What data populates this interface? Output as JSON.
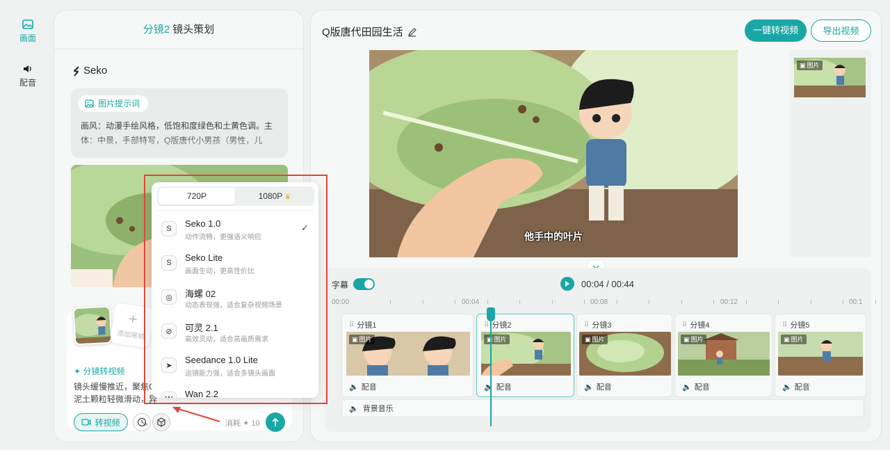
{
  "rail": {
    "items": [
      {
        "label": "画面",
        "active": true,
        "icon": "image-icon"
      },
      {
        "label": "配音",
        "active": false,
        "icon": "speaker-icon"
      }
    ]
  },
  "story": {
    "header_tab": "分镜2",
    "header_title": "镜头策划",
    "logo": "Seko",
    "prompt_chip": "图片提示词",
    "prompt_text": "画风：动漫手绘风格，低饱和度绿色和土黄色调。主体：中景，手部特写，Q版唐代小男孩（男性，儿",
    "add_tail": "添加尾帧",
    "gen_title": "分镜转视频",
    "gen_desc_1": "镜头缓慢推近，聚焦C",
    "gen_desc_2": "泥土颗粒轻微滑动，异",
    "to_video_label": "转视频",
    "clock_badge": "5s",
    "cost_label": "消耗",
    "cost_value": "10"
  },
  "main": {
    "project_title": "Q版唐代田园生活",
    "btn_oneclick": "一键转视频",
    "btn_export": "导出视频",
    "subtitle_text": "他手中的叶片",
    "side_badge": "图片"
  },
  "timeline": {
    "subtitle_label": "字幕",
    "subtitle_on": true,
    "current_time": "00:04",
    "total_time": "00:44",
    "time_sep": "/",
    "ruler": [
      "00:00",
      "00:04",
      "00:08",
      "00:12",
      "00:1"
    ],
    "clips": [
      {
        "label": "分镜1",
        "badge": "图片",
        "dub": "配音",
        "selected": false
      },
      {
        "label": "分镜2",
        "badge": "图片",
        "dub": "配音",
        "selected": true
      },
      {
        "label": "分镜3",
        "badge": "图片",
        "dub": "配音",
        "selected": false
      },
      {
        "label": "分镜4",
        "badge": "图片",
        "dub": "配音",
        "selected": false
      },
      {
        "label": "分镜5",
        "badge": "图片",
        "dub": "配音",
        "selected": false
      }
    ],
    "bgm_label": "背景音乐",
    "playhead_progress": 0.09
  },
  "popover": {
    "resolutions": [
      {
        "label": "720P",
        "selected": true,
        "premium": false
      },
      {
        "label": "1080P",
        "selected": false,
        "premium": true
      }
    ],
    "models": [
      {
        "name": "Seko 1.0",
        "desc": "动作流畅，更强语义响应",
        "selected": true,
        "icon": "seko-icon"
      },
      {
        "name": "Seko Lite",
        "desc": "画面生动，更高性价比",
        "selected": false,
        "icon": "seko-icon"
      },
      {
        "name": "海螺 02",
        "desc": "动态表现强，适合复杂视频场景",
        "selected": false,
        "icon": "hailuo-icon"
      },
      {
        "name": "可灵 2.1",
        "desc": "高效灵动，适合高画质需求",
        "selected": false,
        "icon": "kling-icon"
      },
      {
        "name": "Seedance 1.0 Lite",
        "desc": "运镜能力强，适合多镜头画面",
        "selected": false,
        "icon": "seedance-icon"
      },
      {
        "name": "Wan 2.2",
        "desc": "",
        "selected": false,
        "icon": "wan-icon"
      }
    ]
  },
  "colors": {
    "accent": "#1aa6a6",
    "annotation": "#e0453b"
  }
}
